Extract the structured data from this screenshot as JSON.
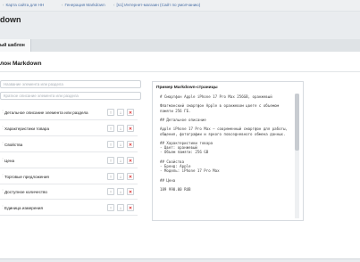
{
  "breadcrumbs": [
    "Карта сайта для HH",
    "Генерация Markdown",
    "[s1] Интернет-магазин (Сайт по умолчанию)"
  ],
  "page_title": "down",
  "tab_label": "ый шаблон",
  "panel_title": "лон Markdown",
  "inputs": {
    "name_placeholder": "Название элемента или раздела",
    "short_desc_placeholder": "Краткое описание элемента или раздела"
  },
  "fields": [
    {
      "label": "Детальное описание элемента или раздела"
    },
    {
      "label": "Характеристики товара"
    },
    {
      "label": "Свойства"
    },
    {
      "label": "Цена"
    },
    {
      "label": "Торговые предложения"
    },
    {
      "label": "Доступное количество"
    },
    {
      "label": "Единица измерения"
    }
  ],
  "buttons": {
    "up": "↑",
    "down": "↓",
    "delete": "✕"
  },
  "preview": {
    "title": "Пример Markdown-страницы",
    "body": "# Смартфон Apple iPhone 17 Pro Max 256GB, оранжевый\n\nФлагманский смартфон Apple в оранжевом цвете с объемом памяти 256 ГБ.\n\n## Детальное описание\n\nApple iPhone 17 Pro Max – современный смартфон для работы, общения, фотографии и яркого повседневного обмена данных.\n\n## Характеристики товара\n- Цвет: оранжевый\n- Объем памяти: 256 GB\n\n## Свойства\n- Бренд: Apple\n- Модель: iPhone 17 Pro Max\n\n## Цена\n\n189 990.00 RUB"
  }
}
